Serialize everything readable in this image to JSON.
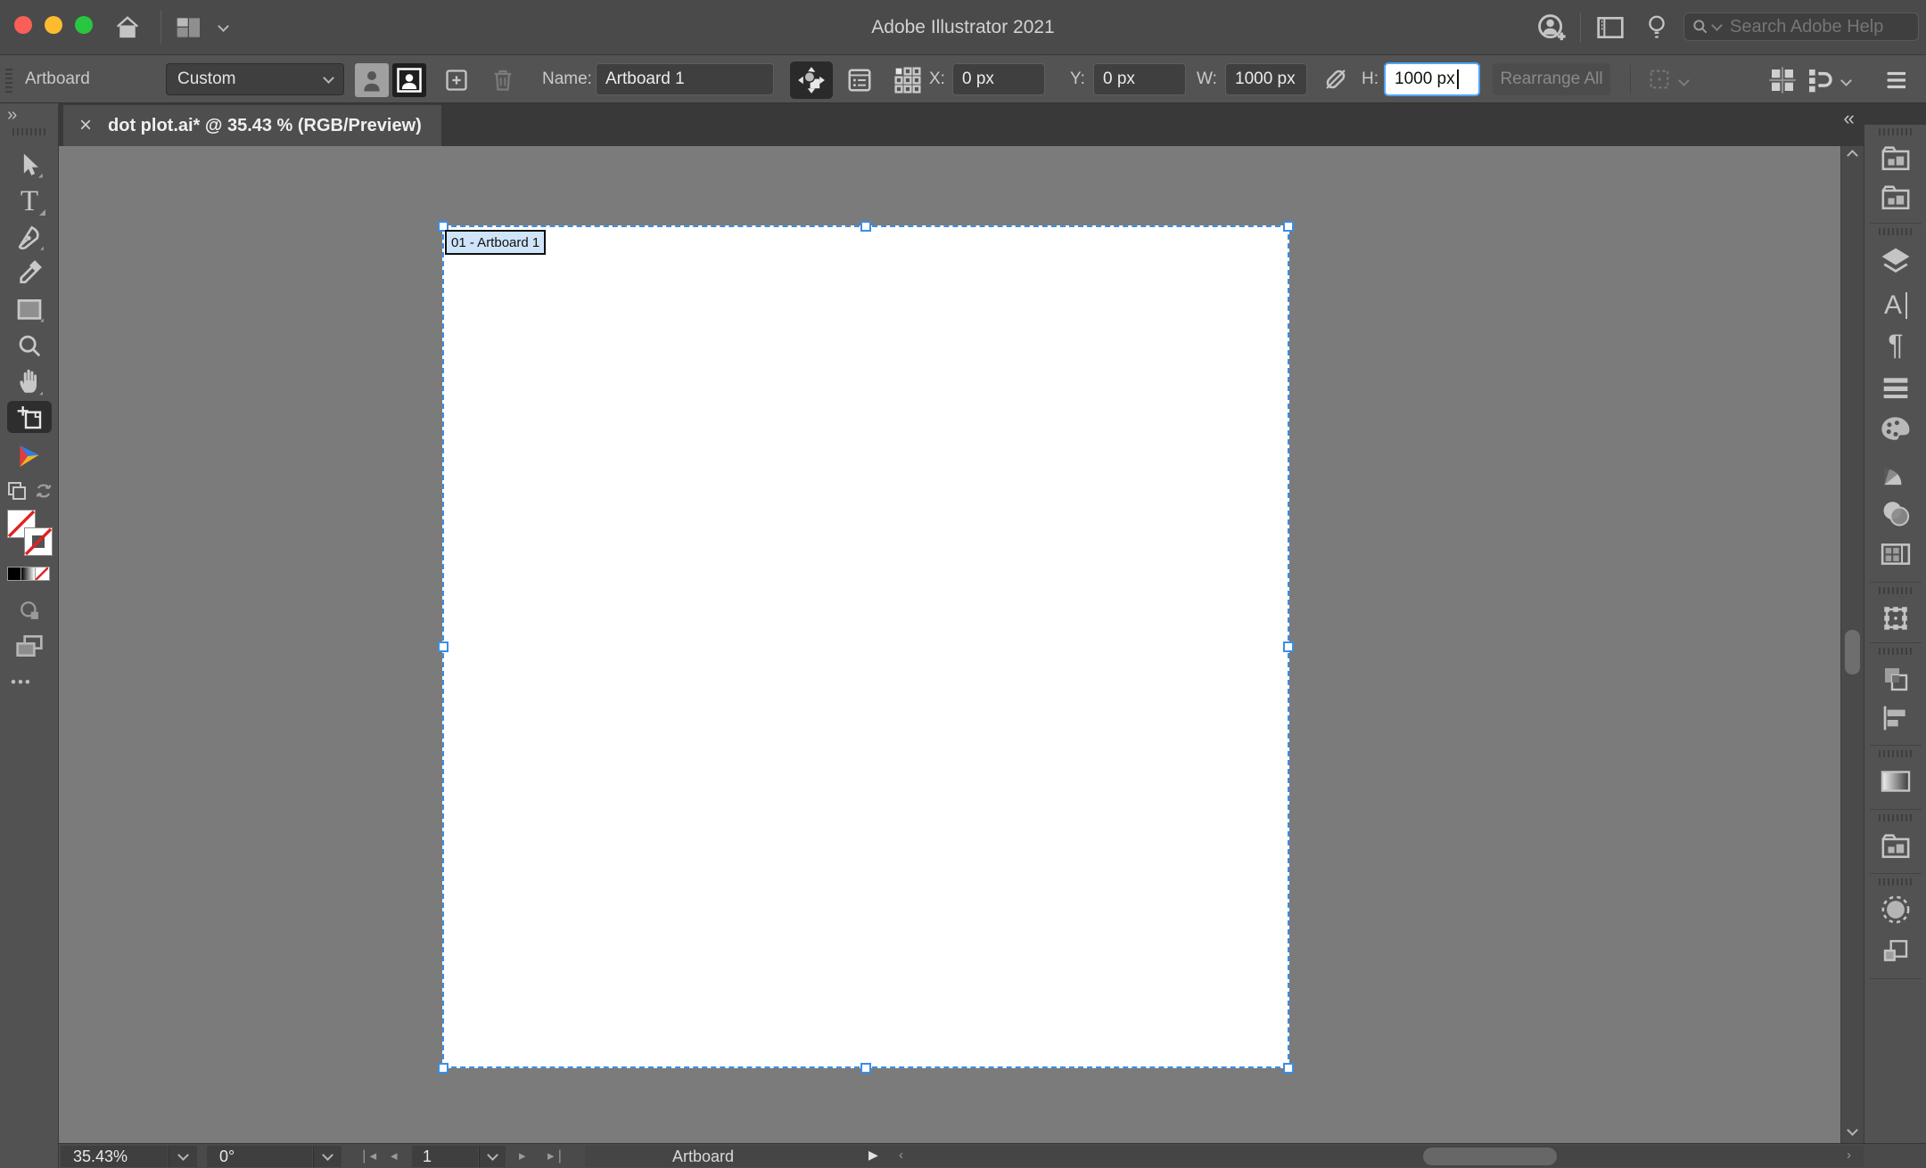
{
  "titlebar": {
    "title": "Adobe Illustrator 2021",
    "search_placeholder": "Search Adobe Help"
  },
  "controlbar": {
    "context_label": "Artboard",
    "preset_value": "Custom",
    "name_label": "Name:",
    "name_value": "Artboard 1",
    "x_label": "X:",
    "x_value": "0 px",
    "y_label": "Y:",
    "y_value": "0 px",
    "w_label": "W:",
    "w_value": "1000 px",
    "h_label": "H:",
    "h_value": "1000 px",
    "rearrange_label": "Rearrange All"
  },
  "tabbar": {
    "close_glyph": "×",
    "tab_title": "dot plot.ai* @ 35.43 % (RGB/Preview)",
    "toolbar_expand_glyph": "››",
    "panel_collapse_glyph": "‹‹"
  },
  "toolbar": {
    "type_tool_glyph": "T",
    "more_tools_glyph": "•••"
  },
  "panels": {
    "character_glyph": "A",
    "paragraph_glyph": "¶"
  },
  "canvas": {
    "artboard_label": "01 - Artboard 1"
  },
  "statusbar": {
    "zoom_value": "35.43%",
    "rotation_value": "0°",
    "artboard_number": "1",
    "status_text": "Artboard"
  },
  "colors": {
    "selection_blue": "#3a8ee6",
    "focus_ring": "#4da3f7",
    "artboard_label_bg": "#cfe4f9",
    "traffic_red": "#f95f57",
    "traffic_yellow": "#fdbc2f",
    "traffic_green": "#29c73f"
  }
}
